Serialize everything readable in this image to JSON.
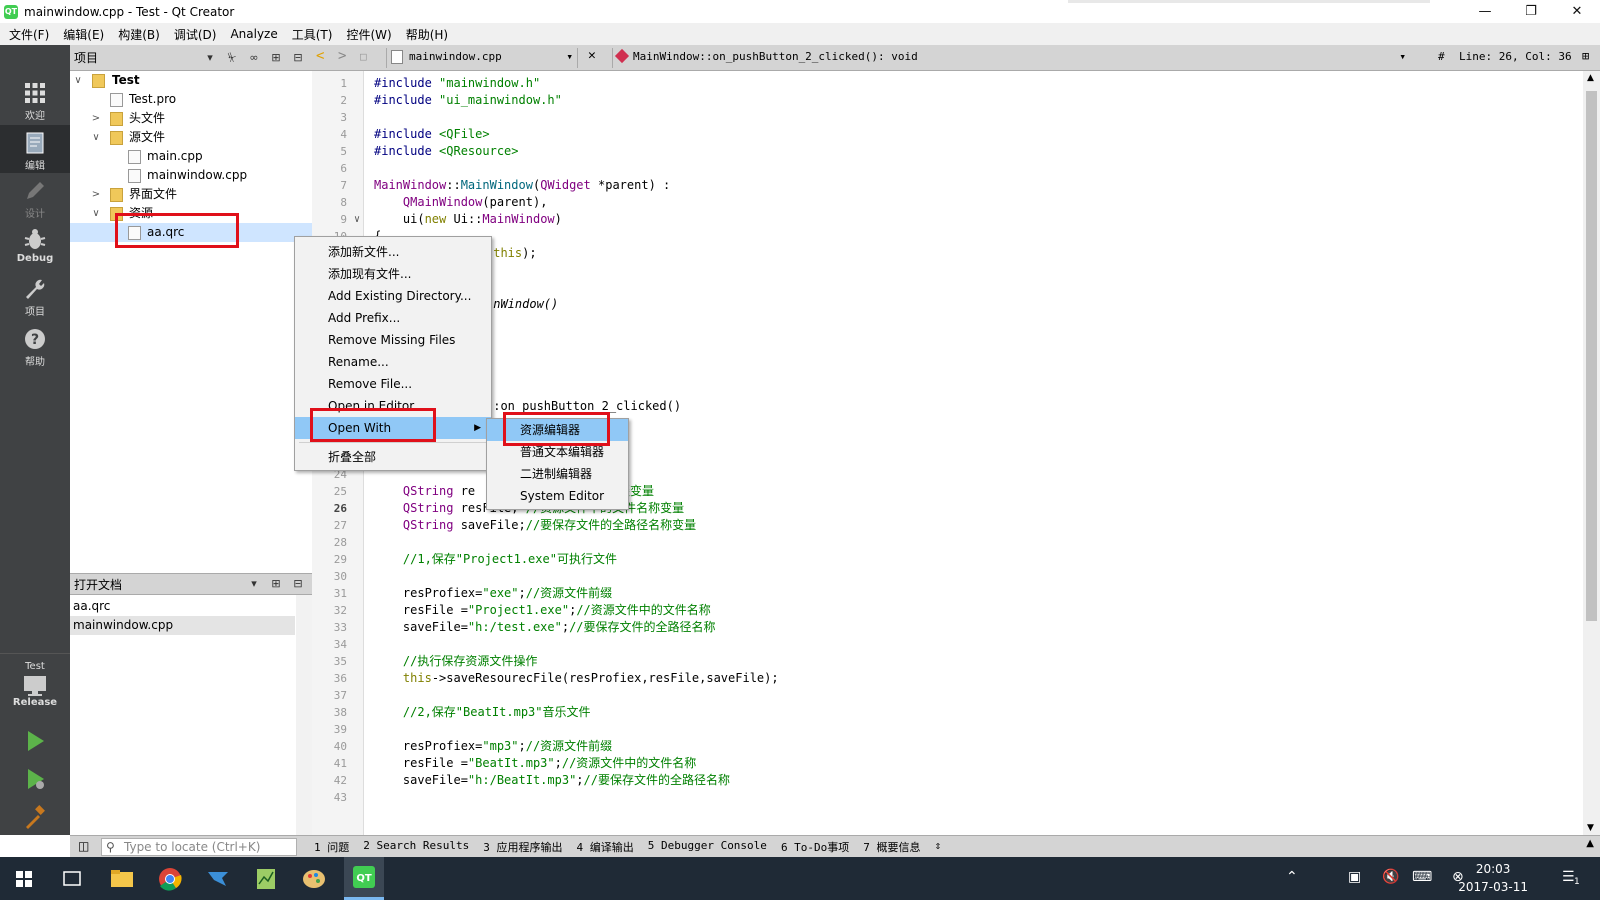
{
  "window": {
    "title": "mainwindow.cpp - Test - Qt Creator",
    "app_icon": "QT"
  },
  "menubar": [
    "文件(F)",
    "编辑(E)",
    "构建(B)",
    "调试(D)",
    "Analyze",
    "工具(T)",
    "控件(W)",
    "帮助(H)"
  ],
  "modes": {
    "welcome": "欢迎",
    "edit": "编辑",
    "design": "设计",
    "debug": "Debug",
    "projects": "项目",
    "help": "帮助",
    "kit": "Test",
    "build_config": "Release"
  },
  "project_pane": {
    "title": "项目",
    "tree": {
      "root": "Test",
      "pro_file": "Test.pro",
      "headers": "头文件",
      "sources": "源文件",
      "main_cpp": "main.cpp",
      "mainwindow_cpp": "mainwindow.cpp",
      "forms": "界面文件",
      "resources": "资源",
      "qrc": "aa.qrc"
    }
  },
  "open_docs": {
    "title": "打开文档",
    "items": [
      "aa.qrc",
      "mainwindow.cpp"
    ]
  },
  "editor_toolbar": {
    "file": "mainwindow.cpp",
    "function": "MainWindow::on_pushButton_2_clicked(): void",
    "hash": "#",
    "position": "Line: 26, Col: 36"
  },
  "line_numbers": [
    "1",
    "2",
    "3",
    "4",
    "5",
    "6",
    "7",
    "8",
    "9",
    "10",
    "",
    "",
    "",
    "",
    "",
    "",
    "",
    "",
    "",
    "",
    "",
    "",
    "",
    "24",
    "25",
    "26",
    "27",
    "28",
    "29",
    "30",
    "31",
    "32",
    "33",
    "34",
    "35",
    "36",
    "37",
    "38",
    "39",
    "40",
    "41",
    "42",
    "43"
  ],
  "code": {
    "l1a": "#include ",
    "l1b": "\"mainwindow.h\"",
    "l2a": "#include ",
    "l2b": "\"ui_mainwindow.h\"",
    "l4a": "#include ",
    "l4b": "<QFile>",
    "l5a": "#include ",
    "l5b": "<QResource>",
    "l7a": "MainWindow",
    "l7b": "::",
    "l7c": "MainWindow",
    "l7d": "(",
    "l7e": "QWidget",
    "l7f": " *parent) :",
    "l8a": "    ",
    "l8b": "QMainWindow",
    "l8c": "(parent),",
    "l9a": "    ui(",
    "l9b": "new",
    "l9c": " Ui::",
    "l9d": "MainWindow",
    "l9e": ")",
    "l10": "{",
    "l11a": "(",
    "l11b": "this",
    "l11c": ");",
    "l14": "inWindow()",
    "l20": "::on_pushButton_2_clicked()",
    "l22": "*/",
    "l25a": "    ",
    "l25b": "QString",
    "l25c": " re",
    "l25d": "前缀变量",
    "l26a": "    ",
    "l26b": "QString",
    "l26c": " resFile; ",
    "l26d": "//资源文件中的文件名称变量",
    "l27a": "    ",
    "l27b": "QString",
    "l27c": " saveFile;",
    "l27d": "//要保存文件的全路径名称变量",
    "l29": "    //1,保存\"Project1.exe\"可执行文件",
    "l31a": "    resProfiex=",
    "l31b": "\"exe\"",
    "l31c": ";",
    "l31d": "//资源文件前缀",
    "l32a": "    resFile =",
    "l32b": "\"Project1.exe\"",
    "l32c": ";",
    "l32d": "//资源文件中的文件名称",
    "l33a": "    saveFile=",
    "l33b": "\"h:/test.exe\"",
    "l33c": ";",
    "l33d": "//要保存文件的全路径名称",
    "l35": "    //执行保存资源文件操作",
    "l36a": "    ",
    "l36b": "this",
    "l36c": "->saveResourecFile(resProfiex,resFile,saveFile);",
    "l38": "    //2,保存\"BeatIt.mp3\"音乐文件",
    "l40a": "    resProfiex=",
    "l40b": "\"mp3\"",
    "l40c": ";",
    "l40d": "//资源文件前缀",
    "l41a": "    resFile =",
    "l41b": "\"BeatIt.mp3\"",
    "l41c": ";",
    "l41d": "//资源文件中的文件名称",
    "l42a": "    saveFile=",
    "l42b": "\"h:/BeatIt.mp3\"",
    "l42c": ";",
    "l42d": "//要保存文件的全路径名称"
  },
  "context_menu": {
    "items": [
      "添加新文件...",
      "添加现有文件...",
      "Add Existing Directory...",
      "Add Prefix...",
      "Remove Missing Files",
      "Rename...",
      "Remove File...",
      "Open in Editor",
      "Open With",
      "折叠全部"
    ]
  },
  "submenu": {
    "items": [
      "资源编辑器",
      "普通文本编辑器",
      "二进制编辑器",
      "System Editor"
    ]
  },
  "statusbar": {
    "locator_placeholder": "Type to locate (Ctrl+K)",
    "tabs": [
      "1 问题",
      "2 Search Results",
      "3 应用程序输出",
      "4 编译输出",
      "5 Debugger Console",
      "6 To-Do事项",
      "7 概要信息"
    ]
  },
  "taskbar": {
    "time": "20:03",
    "date": "2017-03-11",
    "notification_count": "1"
  },
  "colors": {
    "highlight_red": "#e0101a",
    "menu_highlight": "#90c8f6",
    "mode_bar": "#404244"
  }
}
